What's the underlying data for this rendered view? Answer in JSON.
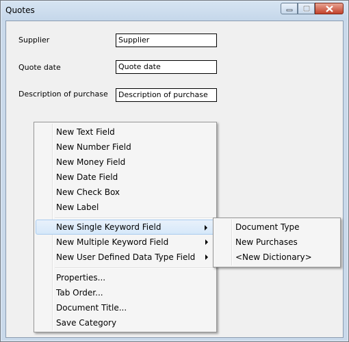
{
  "window": {
    "title": "Quotes"
  },
  "form": {
    "supplier": {
      "label": "Supplier",
      "value": "Supplier"
    },
    "quote_date": {
      "label": "Quote date",
      "value": "Quote date"
    },
    "description": {
      "label": "Description of purchase",
      "value": "Description of purchase"
    }
  },
  "context_menu": {
    "items": [
      "New Text Field",
      "New Number Field",
      "New Money Field",
      "New Date Field",
      "New Check Box",
      "New Label",
      "New Single Keyword Field",
      "New Multiple Keyword Field",
      "New User Defined Data Type Field",
      "Properties...",
      "Tab Order...",
      "Document Title...",
      "Save Category"
    ]
  },
  "submenu": {
    "items": [
      "Document Type",
      "New Purchases",
      "<New Dictionary>"
    ]
  }
}
